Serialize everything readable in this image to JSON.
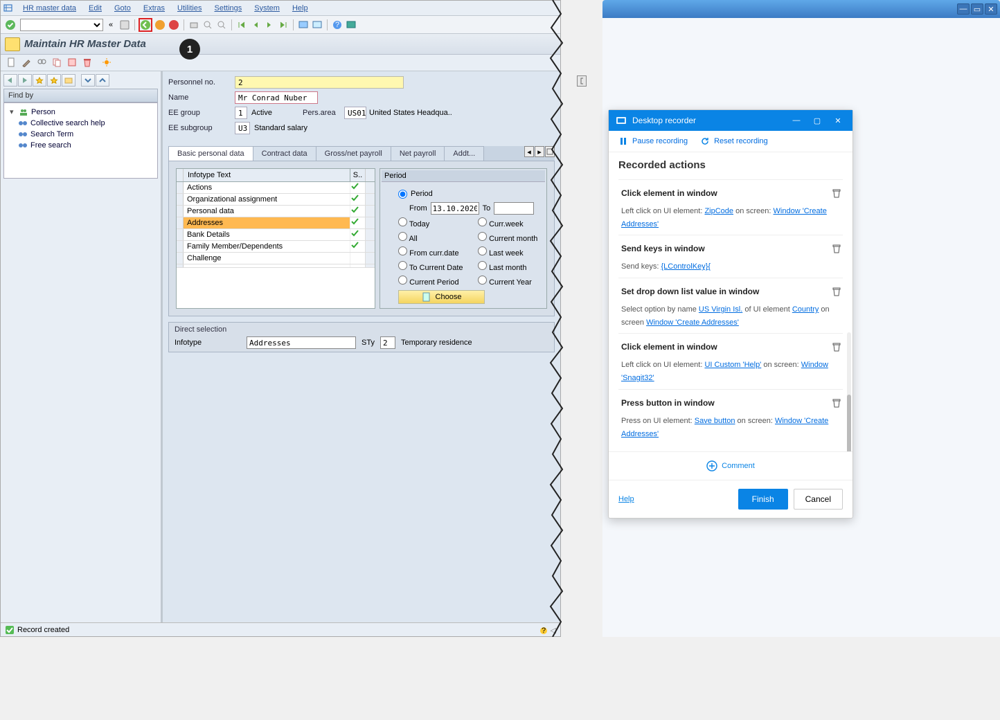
{
  "menubar": [
    "HR master data",
    "Edit",
    "Goto",
    "Extras",
    "Utilities",
    "Settings",
    "System",
    "Help"
  ],
  "page_title": "Maintain HR Master Data",
  "callout": "1",
  "tree": {
    "find_by_label": "Find by",
    "root": "Person",
    "items": [
      "Collective search help",
      "Search Term",
      "Free search"
    ]
  },
  "form": {
    "pers_no_label": "Personnel no.",
    "pers_no_value": "2",
    "name_label": "Name",
    "name_value": "Mr Conrad Nuber",
    "ee_group_label": "EE group",
    "ee_group_code": "1",
    "ee_group_text": "Active",
    "pers_area_label": "Pers.area",
    "pers_area_code": "US01",
    "pers_area_text": "United States Headqua..",
    "ee_subgroup_label": "EE subgroup",
    "ee_subgroup_code": "U3",
    "ee_subgroup_text": "Standard salary"
  },
  "tabs": [
    "Basic personal data",
    "Contract data",
    "Gross/net payroll",
    "Net payroll",
    "Addt..."
  ],
  "tabs_active_index": 0,
  "infotype_table": {
    "header_main": "Infotype Text",
    "header_s": "S..",
    "rows": [
      {
        "text": "Actions",
        "check": true
      },
      {
        "text": "Organizational assignment",
        "check": true
      },
      {
        "text": "Personal data",
        "check": true
      },
      {
        "text": "Addresses",
        "check": true,
        "selected": true
      },
      {
        "text": "Bank Details",
        "check": true
      },
      {
        "text": "Family Member/Dependents",
        "check": true
      },
      {
        "text": "Challenge",
        "check": false
      },
      {
        "text": "",
        "check": false
      }
    ]
  },
  "period_box": {
    "header": "Period",
    "period_label": "Period",
    "from_label": "From",
    "from_value": "13.10.2020",
    "to_label": "To",
    "to_value": "",
    "options_l": [
      "Today",
      "All",
      "From curr.date",
      "To Current Date",
      "Current Period"
    ],
    "options_r": [
      "Curr.week",
      "Current month",
      "Last week",
      "Last month",
      "Current Year"
    ],
    "choose_label": "Choose"
  },
  "direct_selection": {
    "header": "Direct selection",
    "infotype_label": "Infotype",
    "infotype_value": "Addresses",
    "sty_label": "STy",
    "sty_value": "2",
    "sty_text": "Temporary residence"
  },
  "status_text": "Record created",
  "recorder": {
    "title": "Desktop recorder",
    "pause": "Pause recording",
    "reset": "Reset recording",
    "heading": "Recorded actions",
    "actions": [
      {
        "title": "Click element in window",
        "desc_pre": "Left click on UI element: ",
        "link1": "ZipCode",
        "desc_mid": " on screen: ",
        "link2": "Window 'Create Addresses'"
      },
      {
        "title": "Send keys in window",
        "desc_pre": "Send keys: ",
        "link1": "{LControlKey}{"
      },
      {
        "title": "Set drop down list value in window",
        "desc_pre": "Select option by name ",
        "link1": "US Virgin Isl.",
        "desc_mid": " of UI element ",
        "link2": "Country",
        "desc_post": " on screen ",
        "link3": "Window 'Create Addresses'"
      },
      {
        "title": "Click element in window",
        "desc_pre": "Left click on UI element: ",
        "link1": "UI Custom 'Help'",
        "desc_mid": " on screen: ",
        "link2": "Window 'Snagit32'"
      },
      {
        "title": "Press button in window",
        "desc_pre": "Press on UI element: ",
        "link1": "Save button",
        "desc_mid": " on screen: ",
        "link2": "Window 'Create Addresses'"
      }
    ],
    "comment": "Comment",
    "help": "Help",
    "finish": "Finish",
    "cancel": "Cancel"
  }
}
